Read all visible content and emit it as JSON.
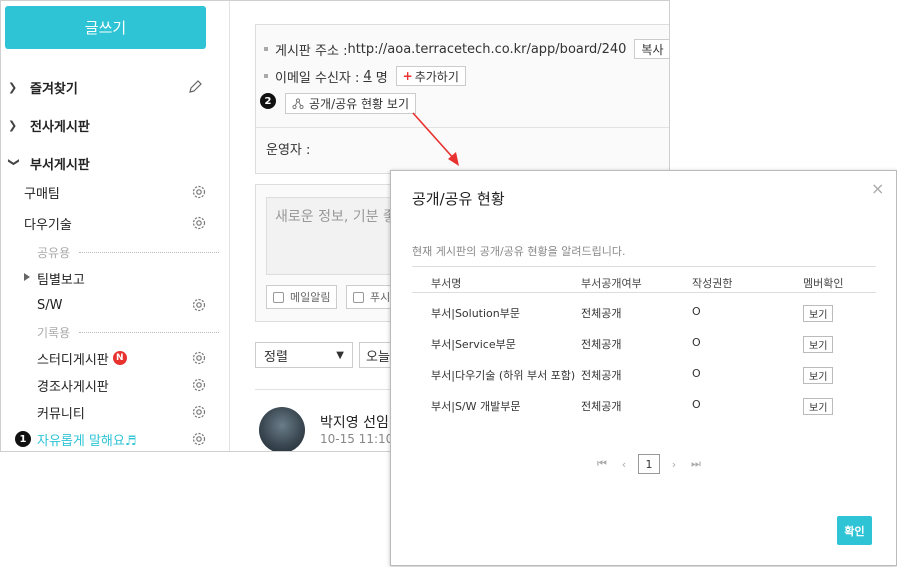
{
  "sidebar": {
    "write_button": "글쓰기",
    "favorites": "즐겨찾기",
    "company_boards": "전사게시판",
    "dept_boards": "부서게시판",
    "items": [
      {
        "label": "구매팀"
      },
      {
        "label": "다우기술"
      }
    ],
    "group_shared": "공유용",
    "team_report": "팀별보고",
    "sw": "S/W",
    "group_record": "기록용",
    "study_board": "스터디게시판",
    "new_badge": "N",
    "condolence": "경조사게시판",
    "community": "커뮤니티",
    "free_talk": "자유롭게 말해요♬",
    "marker_1": "1"
  },
  "content": {
    "board_address_label": "게시판 주소 :",
    "board_address_url": "http://aoa.terracetech.co.kr/app/board/240",
    "copy_button": "복사",
    "email_label": "이메일 수신자 :",
    "email_count": "4",
    "email_unit": "명",
    "add_button": "추가하기",
    "marker_2": "2",
    "share_button": "공개/공유 현황 보기",
    "operator_label": "운영자 :",
    "compose_placeholder": "새로운 정보, 기분 좋",
    "mail_notify": "메일알림",
    "push_partial": "푸시",
    "sort_label": "정렬",
    "date_partial": "오늘",
    "post_name": "박지영 선임",
    "post_date": "10-15 11:10"
  },
  "modal": {
    "title": "공개/공유 현황",
    "close": "×",
    "description": "현재 게시판의 공개/공유 현황을 알려드립니다.",
    "headers": [
      "부서명",
      "부서공개여부",
      "작성권한",
      "멤버확인"
    ],
    "rows": [
      {
        "dept": "부서|Solution부문",
        "public": "전체공개",
        "auth": "O",
        "view": "보기"
      },
      {
        "dept": "부서|Service부문",
        "public": "전체공개",
        "auth": "O",
        "view": "보기"
      },
      {
        "dept": "부서|다우기술 (하위 부서 포함)",
        "public": "전체공개",
        "auth": "O",
        "view": "보기"
      },
      {
        "dept": "부서|S/W 개발부문",
        "public": "전체공개",
        "auth": "O",
        "view": "보기"
      }
    ],
    "pager": {
      "first": "⏮",
      "prev": "‹",
      "page": "1",
      "next": "›",
      "last": "⏭"
    },
    "confirm": "확인"
  },
  "colors": {
    "accent": "#2ec4d6",
    "badge": "#e8322f",
    "arrow": "#e8322f"
  }
}
